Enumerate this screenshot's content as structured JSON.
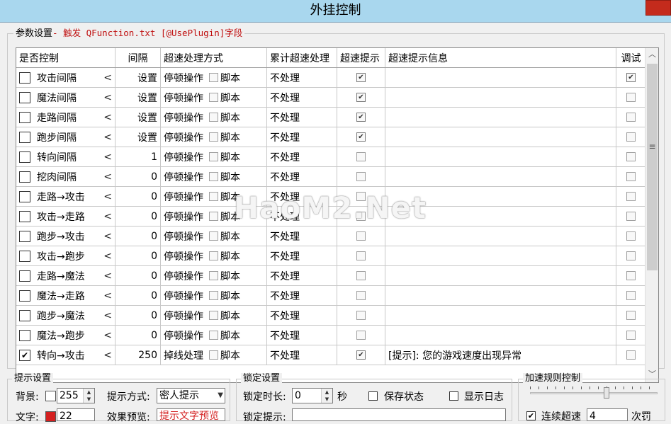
{
  "window": {
    "title": "外挂控制"
  },
  "params_group": {
    "legend_prefix": "参数设置",
    "legend_suffix": "- 触发 QFunction.txt [@UsePlugin]字段"
  },
  "table": {
    "headers": [
      "是否控制",
      "间隔",
      "超速处理方式",
      "累计超速处理",
      "超速提示",
      "超速提示信息",
      "调试"
    ],
    "script_label": "脚本",
    "lt_arrow": "<",
    "rows": [
      {
        "enabled": false,
        "name": "攻击间隔",
        "interval": "设置",
        "mode": "停顿操作",
        "cumulative": "不处理",
        "prompt": true,
        "msg": "",
        "debug": true
      },
      {
        "enabled": false,
        "name": "魔法间隔",
        "interval": "设置",
        "mode": "停顿操作",
        "cumulative": "不处理",
        "prompt": true,
        "msg": "",
        "debug": false
      },
      {
        "enabled": false,
        "name": "走路间隔",
        "interval": "设置",
        "mode": "停顿操作",
        "cumulative": "不处理",
        "prompt": true,
        "msg": "",
        "debug": false
      },
      {
        "enabled": false,
        "name": "跑步间隔",
        "interval": "设置",
        "mode": "停顿操作",
        "cumulative": "不处理",
        "prompt": true,
        "msg": "",
        "debug": false
      },
      {
        "enabled": false,
        "name": "转向间隔",
        "interval": "1",
        "mode": "停顿操作",
        "cumulative": "不处理",
        "prompt": false,
        "msg": "",
        "debug": false
      },
      {
        "enabled": false,
        "name": "挖肉间隔",
        "interval": "0",
        "mode": "停顿操作",
        "cumulative": "不处理",
        "prompt": false,
        "msg": "",
        "debug": false
      },
      {
        "enabled": false,
        "name": "走路→攻击",
        "interval": "0",
        "mode": "停顿操作",
        "cumulative": "不处理",
        "prompt": false,
        "msg": "",
        "debug": false
      },
      {
        "enabled": false,
        "name": "攻击→走路",
        "interval": "0",
        "mode": "停顿操作",
        "cumulative": "不处理",
        "prompt": false,
        "msg": "",
        "debug": false
      },
      {
        "enabled": false,
        "name": "跑步→攻击",
        "interval": "0",
        "mode": "停顿操作",
        "cumulative": "不处理",
        "prompt": false,
        "msg": "",
        "debug": false
      },
      {
        "enabled": false,
        "name": "攻击→跑步",
        "interval": "0",
        "mode": "停顿操作",
        "cumulative": "不处理",
        "prompt": false,
        "msg": "",
        "debug": false
      },
      {
        "enabled": false,
        "name": "走路→魔法",
        "interval": "0",
        "mode": "停顿操作",
        "cumulative": "不处理",
        "prompt": false,
        "msg": "",
        "debug": false
      },
      {
        "enabled": false,
        "name": "魔法→走路",
        "interval": "0",
        "mode": "停顿操作",
        "cumulative": "不处理",
        "prompt": false,
        "msg": "",
        "debug": false
      },
      {
        "enabled": false,
        "name": "跑步→魔法",
        "interval": "0",
        "mode": "停顿操作",
        "cumulative": "不处理",
        "prompt": false,
        "msg": "",
        "debug": false
      },
      {
        "enabled": false,
        "name": "魔法→跑步",
        "interval": "0",
        "mode": "停顿操作",
        "cumulative": "不处理",
        "prompt": false,
        "msg": "",
        "debug": false
      },
      {
        "enabled": true,
        "name": "转向→攻击",
        "interval": "250",
        "mode": "掉线处理",
        "cumulative": "不处理",
        "prompt": true,
        "msg": "[提示]: 您的游戏速度出现异常",
        "debug": false
      }
    ]
  },
  "watermark": "HaoM2.Net",
  "prompt_group": {
    "legend": "提示设置",
    "bg_label": "背景:",
    "bg_value": "255",
    "bg_color": "#ffffff",
    "text_label": "文字:",
    "text_value": "22",
    "text_color": "#d42020",
    "mode_label": "提示方式:",
    "mode_value": "密人提示",
    "preview_label": "效果预览:",
    "preview_value": "提示文字预览"
  },
  "lock_group": {
    "legend": "锁定设置",
    "duration_label": "锁定时长:",
    "duration_value": "0",
    "unit": "秒",
    "save_state": "保存状态",
    "show_log": "显示日志",
    "lock_prompt_label": "锁定提示:"
  },
  "accel_group": {
    "legend": "加速规则控制",
    "slider_level": 0.6,
    "continuous_label": "连续超速",
    "continuous_value": "4",
    "times_label": "次罚"
  },
  "colors": {
    "title_bar": "#a9d7ee",
    "close_button": "#c42b1c",
    "legend_accent": "#c01010"
  }
}
